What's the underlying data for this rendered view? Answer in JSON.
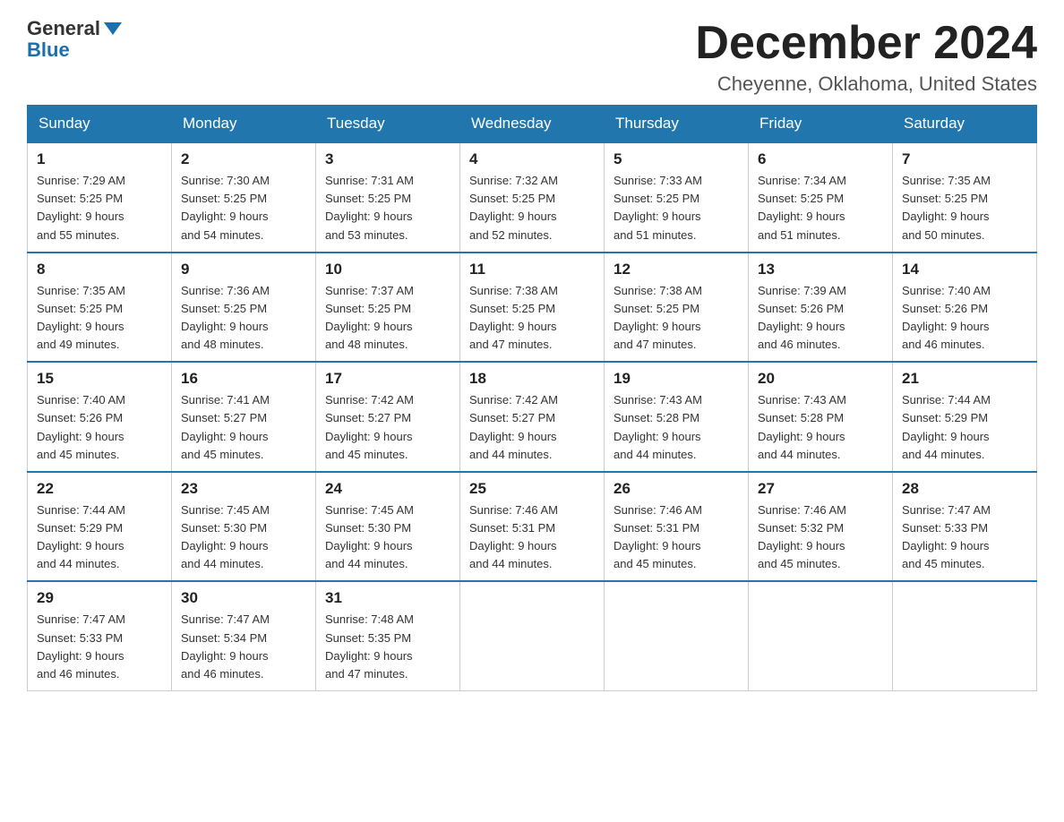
{
  "header": {
    "logo_general": "General",
    "logo_blue": "Blue",
    "month_title": "December 2024",
    "location": "Cheyenne, Oklahoma, United States"
  },
  "days_of_week": [
    "Sunday",
    "Monday",
    "Tuesday",
    "Wednesday",
    "Thursday",
    "Friday",
    "Saturday"
  ],
  "weeks": [
    [
      {
        "day": "1",
        "sunrise": "7:29 AM",
        "sunset": "5:25 PM",
        "daylight": "9 hours and 55 minutes."
      },
      {
        "day": "2",
        "sunrise": "7:30 AM",
        "sunset": "5:25 PM",
        "daylight": "9 hours and 54 minutes."
      },
      {
        "day": "3",
        "sunrise": "7:31 AM",
        "sunset": "5:25 PM",
        "daylight": "9 hours and 53 minutes."
      },
      {
        "day": "4",
        "sunrise": "7:32 AM",
        "sunset": "5:25 PM",
        "daylight": "9 hours and 52 minutes."
      },
      {
        "day": "5",
        "sunrise": "7:33 AM",
        "sunset": "5:25 PM",
        "daylight": "9 hours and 51 minutes."
      },
      {
        "day": "6",
        "sunrise": "7:34 AM",
        "sunset": "5:25 PM",
        "daylight": "9 hours and 51 minutes."
      },
      {
        "day": "7",
        "sunrise": "7:35 AM",
        "sunset": "5:25 PM",
        "daylight": "9 hours and 50 minutes."
      }
    ],
    [
      {
        "day": "8",
        "sunrise": "7:35 AM",
        "sunset": "5:25 PM",
        "daylight": "9 hours and 49 minutes."
      },
      {
        "day": "9",
        "sunrise": "7:36 AM",
        "sunset": "5:25 PM",
        "daylight": "9 hours and 48 minutes."
      },
      {
        "day": "10",
        "sunrise": "7:37 AM",
        "sunset": "5:25 PM",
        "daylight": "9 hours and 48 minutes."
      },
      {
        "day": "11",
        "sunrise": "7:38 AM",
        "sunset": "5:25 PM",
        "daylight": "9 hours and 47 minutes."
      },
      {
        "day": "12",
        "sunrise": "7:38 AM",
        "sunset": "5:25 PM",
        "daylight": "9 hours and 47 minutes."
      },
      {
        "day": "13",
        "sunrise": "7:39 AM",
        "sunset": "5:26 PM",
        "daylight": "9 hours and 46 minutes."
      },
      {
        "day": "14",
        "sunrise": "7:40 AM",
        "sunset": "5:26 PM",
        "daylight": "9 hours and 46 minutes."
      }
    ],
    [
      {
        "day": "15",
        "sunrise": "7:40 AM",
        "sunset": "5:26 PM",
        "daylight": "9 hours and 45 minutes."
      },
      {
        "day": "16",
        "sunrise": "7:41 AM",
        "sunset": "5:27 PM",
        "daylight": "9 hours and 45 minutes."
      },
      {
        "day": "17",
        "sunrise": "7:42 AM",
        "sunset": "5:27 PM",
        "daylight": "9 hours and 45 minutes."
      },
      {
        "day": "18",
        "sunrise": "7:42 AM",
        "sunset": "5:27 PM",
        "daylight": "9 hours and 44 minutes."
      },
      {
        "day": "19",
        "sunrise": "7:43 AM",
        "sunset": "5:28 PM",
        "daylight": "9 hours and 44 minutes."
      },
      {
        "day": "20",
        "sunrise": "7:43 AM",
        "sunset": "5:28 PM",
        "daylight": "9 hours and 44 minutes."
      },
      {
        "day": "21",
        "sunrise": "7:44 AM",
        "sunset": "5:29 PM",
        "daylight": "9 hours and 44 minutes."
      }
    ],
    [
      {
        "day": "22",
        "sunrise": "7:44 AM",
        "sunset": "5:29 PM",
        "daylight": "9 hours and 44 minutes."
      },
      {
        "day": "23",
        "sunrise": "7:45 AM",
        "sunset": "5:30 PM",
        "daylight": "9 hours and 44 minutes."
      },
      {
        "day": "24",
        "sunrise": "7:45 AM",
        "sunset": "5:30 PM",
        "daylight": "9 hours and 44 minutes."
      },
      {
        "day": "25",
        "sunrise": "7:46 AM",
        "sunset": "5:31 PM",
        "daylight": "9 hours and 44 minutes."
      },
      {
        "day": "26",
        "sunrise": "7:46 AM",
        "sunset": "5:31 PM",
        "daylight": "9 hours and 45 minutes."
      },
      {
        "day": "27",
        "sunrise": "7:46 AM",
        "sunset": "5:32 PM",
        "daylight": "9 hours and 45 minutes."
      },
      {
        "day": "28",
        "sunrise": "7:47 AM",
        "sunset": "5:33 PM",
        "daylight": "9 hours and 45 minutes."
      }
    ],
    [
      {
        "day": "29",
        "sunrise": "7:47 AM",
        "sunset": "5:33 PM",
        "daylight": "9 hours and 46 minutes."
      },
      {
        "day": "30",
        "sunrise": "7:47 AM",
        "sunset": "5:34 PM",
        "daylight": "9 hours and 46 minutes."
      },
      {
        "day": "31",
        "sunrise": "7:48 AM",
        "sunset": "5:35 PM",
        "daylight": "9 hours and 47 minutes."
      },
      null,
      null,
      null,
      null
    ]
  ],
  "labels": {
    "sunrise_prefix": "Sunrise: ",
    "sunset_prefix": "Sunset: ",
    "daylight_prefix": "Daylight: "
  }
}
